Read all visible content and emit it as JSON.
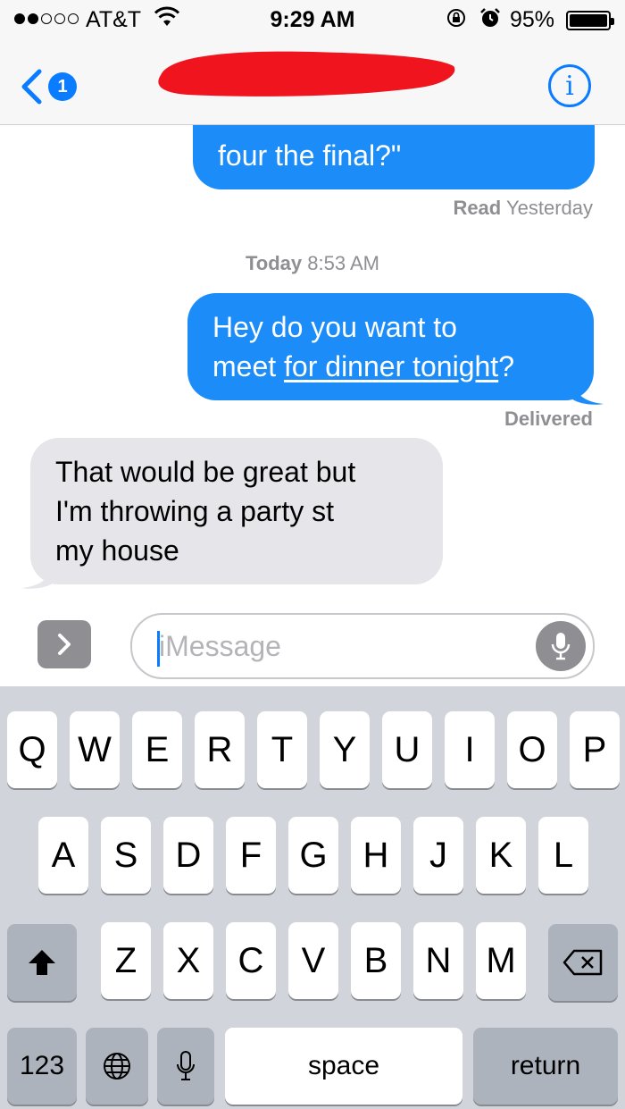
{
  "status_bar": {
    "carrier": "AT&T",
    "time": "9:29 AM",
    "battery_percent": "95%",
    "signal_filled": 2,
    "signal_total": 5,
    "icons": [
      "wifi-icon",
      "orientation-lock-icon",
      "alarm-icon",
      "battery-icon"
    ]
  },
  "nav": {
    "back_badge": "1",
    "info_label": "i",
    "accent_color": "#0a7cff"
  },
  "messages": {
    "first": {
      "line": "four the final?\""
    },
    "read_label": "Read",
    "read_time": "Yesterday",
    "today_label": "Today",
    "today_time": "8:53 AM",
    "second": {
      "line1": "Hey do you want to",
      "line2_prefix": "meet ",
      "line2_link": "for dinner tonight",
      "line2_suffix": "?"
    },
    "delivered_label": "Delivered",
    "third": {
      "line1": "That would be great but",
      "line2": "I'm throwing a party st",
      "line3": "my house"
    }
  },
  "input": {
    "placeholder": "iMessage"
  },
  "keyboard": {
    "row1": [
      "Q",
      "W",
      "E",
      "R",
      "T",
      "Y",
      "U",
      "I",
      "O",
      "P"
    ],
    "row2": [
      "A",
      "S",
      "D",
      "F",
      "G",
      "H",
      "J",
      "K",
      "L"
    ],
    "row3": [
      "Z",
      "X",
      "C",
      "V",
      "B",
      "N",
      "M"
    ],
    "numbers_label": "123",
    "space_label": "space",
    "return_label": "return"
  }
}
